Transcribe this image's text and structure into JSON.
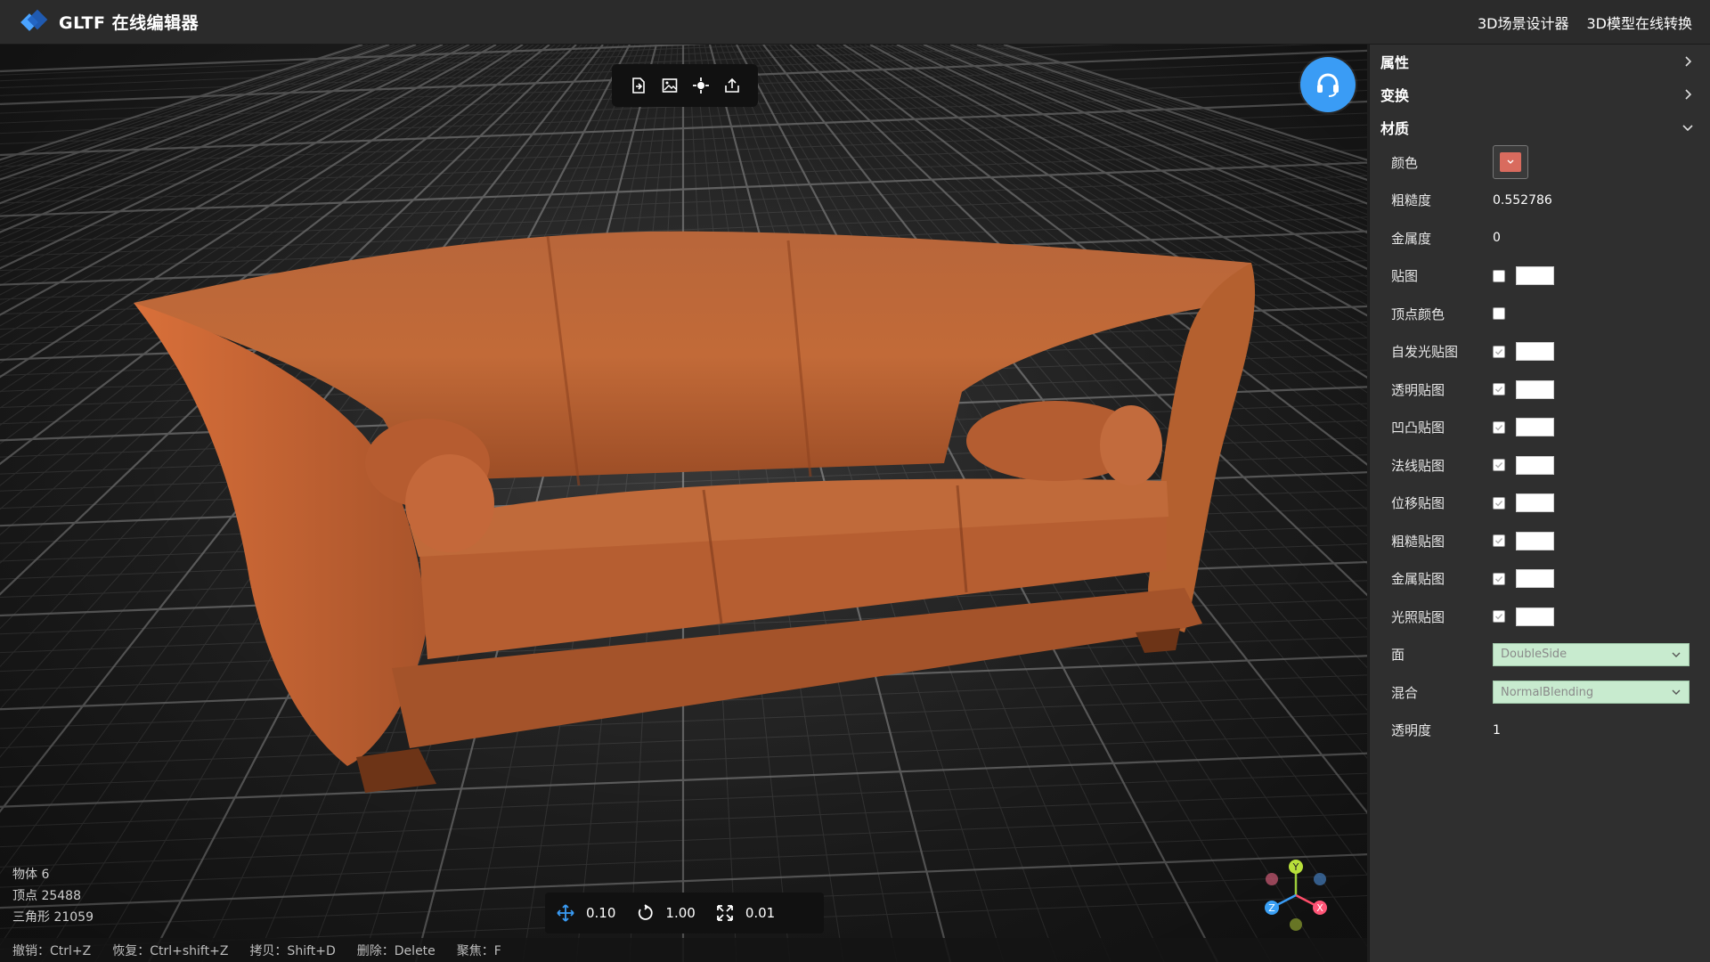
{
  "header": {
    "title": "GLTF 在线编辑器",
    "links": [
      "3D场景设计器",
      "3D模型在线转换"
    ]
  },
  "toolbar": {
    "icons": [
      "import-icon",
      "image-export-icon",
      "focus-icon",
      "share-export-icon"
    ]
  },
  "stats": {
    "objects": "物体 6",
    "vertices": "顶点 25488",
    "triangles": "三角形 21059"
  },
  "transform": {
    "move": "0.10",
    "rotate": "1.00",
    "scale": "0.01"
  },
  "shortcuts": [
    "撤销：Ctrl+Z",
    "恢复：Ctrl+shift+Z",
    "拷贝：Shift+D",
    "删除：Delete",
    "聚焦：F"
  ],
  "gizmo": {
    "x": "X",
    "y": "Y",
    "z": "Z"
  },
  "panel": {
    "sections": {
      "properties": "属性",
      "transform": "变换",
      "material": "材质"
    },
    "material": {
      "color_label": "颜色",
      "color_value": "#d96b5e",
      "roughness_label": "粗糙度",
      "roughness": "0.552786",
      "metalness_label": "金属度",
      "metalness": "0",
      "map_label": "贴图",
      "vertex_colors_label": "顶点颜色",
      "emissive_map_label": "自发光贴图",
      "alpha_map_label": "透明贴图",
      "bump_map_label": "凹凸贴图",
      "normal_map_label": "法线贴图",
      "displacement_map_label": "位移贴图",
      "roughness_map_label": "粗糙贴图",
      "metalness_map_label": "金属贴图",
      "light_map_label": "光照贴图",
      "side_label": "面",
      "side": "DoubleSide",
      "blending_label": "混合",
      "blending": "NormalBlending",
      "opacity_label": "透明度",
      "opacity": "1"
    }
  },
  "colors": {
    "accent": "#3a9cf5",
    "sofa": "#b85a2e",
    "select_bg": "#c8ebcf"
  }
}
